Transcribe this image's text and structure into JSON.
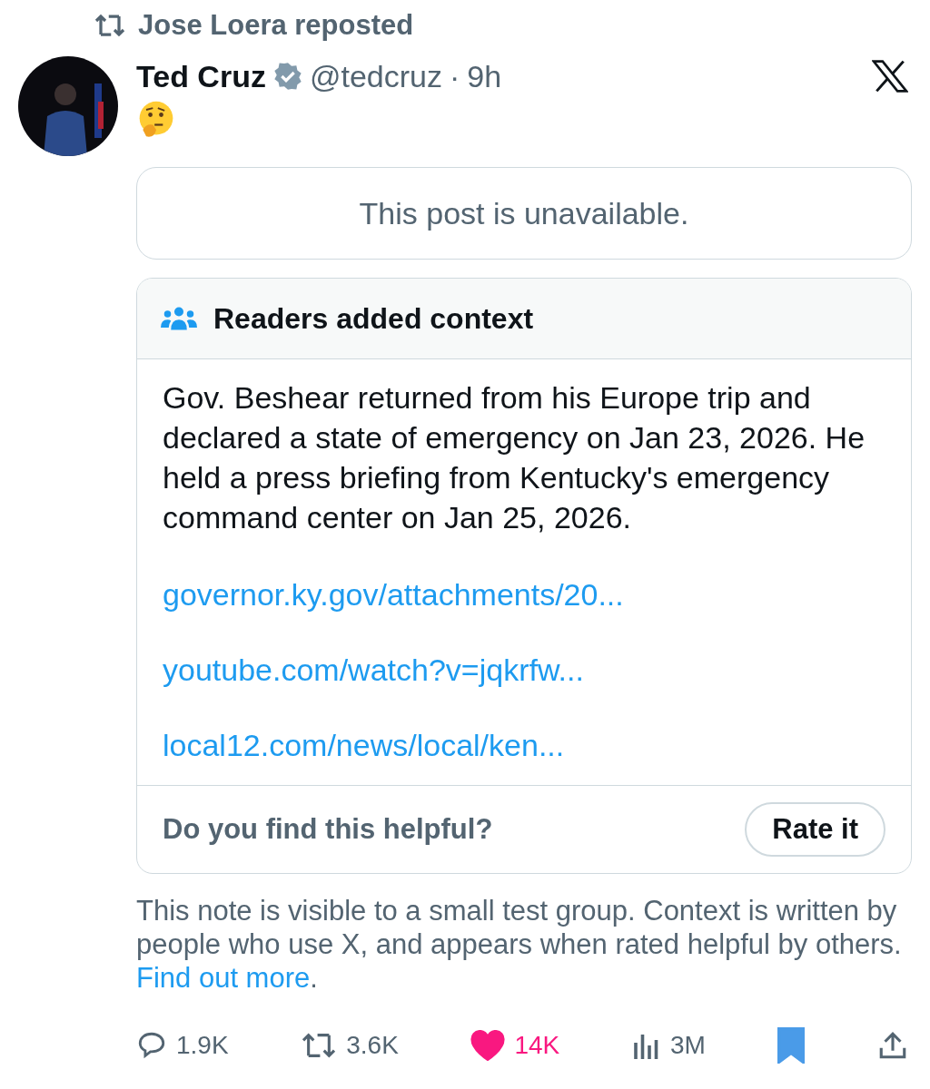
{
  "repost": {
    "text": "Jose Loera reposted"
  },
  "author": {
    "name": "Ted Cruz",
    "verified": true,
    "handle": "@tedcruz",
    "separator": "·",
    "time": "9h"
  },
  "unavailable": {
    "text": "This post is unavailable."
  },
  "note": {
    "title": "Readers added context",
    "body": "Gov. Beshear returned from his Europe trip and declared a state of emergency on Jan 23, 2026. He held a press briefing from Kentucky's emergency command center on Jan 25, 2026.",
    "links": [
      "governor.ky.gov/attachments/20...",
      "youtube.com/watch?v=jqkrfw...",
      "local12.com/news/local/ken..."
    ],
    "question": "Do you find this helpful?",
    "button": "Rate it"
  },
  "disclaimer": {
    "text": "This note is visible to a small test group. Context is written by people who use X, and appears when rated helpful by others.",
    "link": "Find out more",
    "end": "."
  },
  "actions": [
    {
      "kind": "reply",
      "count": "1.9K"
    },
    {
      "kind": "repost",
      "count": "3.6K"
    },
    {
      "kind": "like",
      "count": "14K",
      "active": true
    },
    {
      "kind": "views",
      "count": "3M"
    },
    {
      "kind": "bookmark",
      "active": true
    },
    {
      "kind": "share"
    }
  ]
}
